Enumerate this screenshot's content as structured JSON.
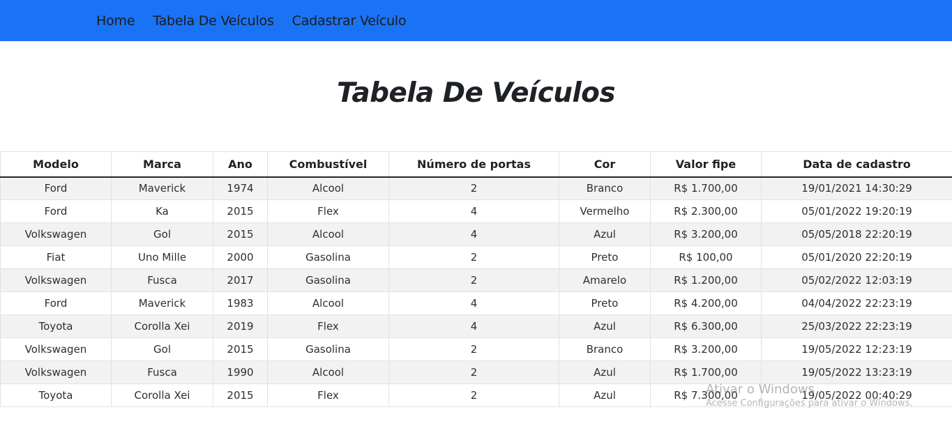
{
  "nav": {
    "items": [
      {
        "label": "Home"
      },
      {
        "label": "Tabela De Veículos"
      },
      {
        "label": "Cadastrar Veículo"
      }
    ],
    "background": "#1a73f5"
  },
  "page": {
    "title": "Tabela De Veículos"
  },
  "table": {
    "headers": [
      "Modelo",
      "Marca",
      "Ano",
      "Combustível",
      "Número de portas",
      "Cor",
      "Valor fipe",
      "Data de cadastro"
    ],
    "rows": [
      [
        "Ford",
        "Maverick",
        "1974",
        "Alcool",
        "2",
        "Branco",
        "R$ 1.700,00",
        "19/01/2021 14:30:29"
      ],
      [
        "Ford",
        "Ka",
        "2015",
        "Flex",
        "4",
        "Vermelho",
        "R$ 2.300,00",
        "05/01/2022 19:20:19"
      ],
      [
        "Volkswagen",
        "Gol",
        "2015",
        "Alcool",
        "4",
        "Azul",
        "R$ 3.200,00",
        "05/05/2018 22:20:19"
      ],
      [
        "Fiat",
        "Uno Mille",
        "2000",
        "Gasolina",
        "2",
        "Preto",
        "R$ 100,00",
        "05/01/2020 22:20:19"
      ],
      [
        "Volkswagen",
        "Fusca",
        "2017",
        "Gasolina",
        "2",
        "Amarelo",
        "R$ 1.200,00",
        "05/02/2022 12:03:19"
      ],
      [
        "Ford",
        "Maverick",
        "1983",
        "Alcool",
        "4",
        "Preto",
        "R$ 4.200,00",
        "04/04/2022 22:23:19"
      ],
      [
        "Toyota",
        "Corolla Xei",
        "2019",
        "Flex",
        "4",
        "Azul",
        "R$ 6.300,00",
        "25/03/2022 22:23:19"
      ],
      [
        "Volkswagen",
        "Gol",
        "2015",
        "Gasolina",
        "2",
        "Branco",
        "R$ 3.200,00",
        "19/05/2022 12:23:19"
      ],
      [
        "Volkswagen",
        "Fusca",
        "1990",
        "Alcool",
        "2",
        "Azul",
        "R$ 1.700,00",
        "19/05/2022 13:23:19"
      ],
      [
        "Toyota",
        "Corolla Xei",
        "2015",
        "Flex",
        "2",
        "Azul",
        "R$ 7.300,00",
        "19/05/2022 00:40:29"
      ]
    ]
  },
  "watermark": {
    "line1": "Ativar o Windows",
    "line2": "Acesse Configurações para ativar o Windows."
  }
}
